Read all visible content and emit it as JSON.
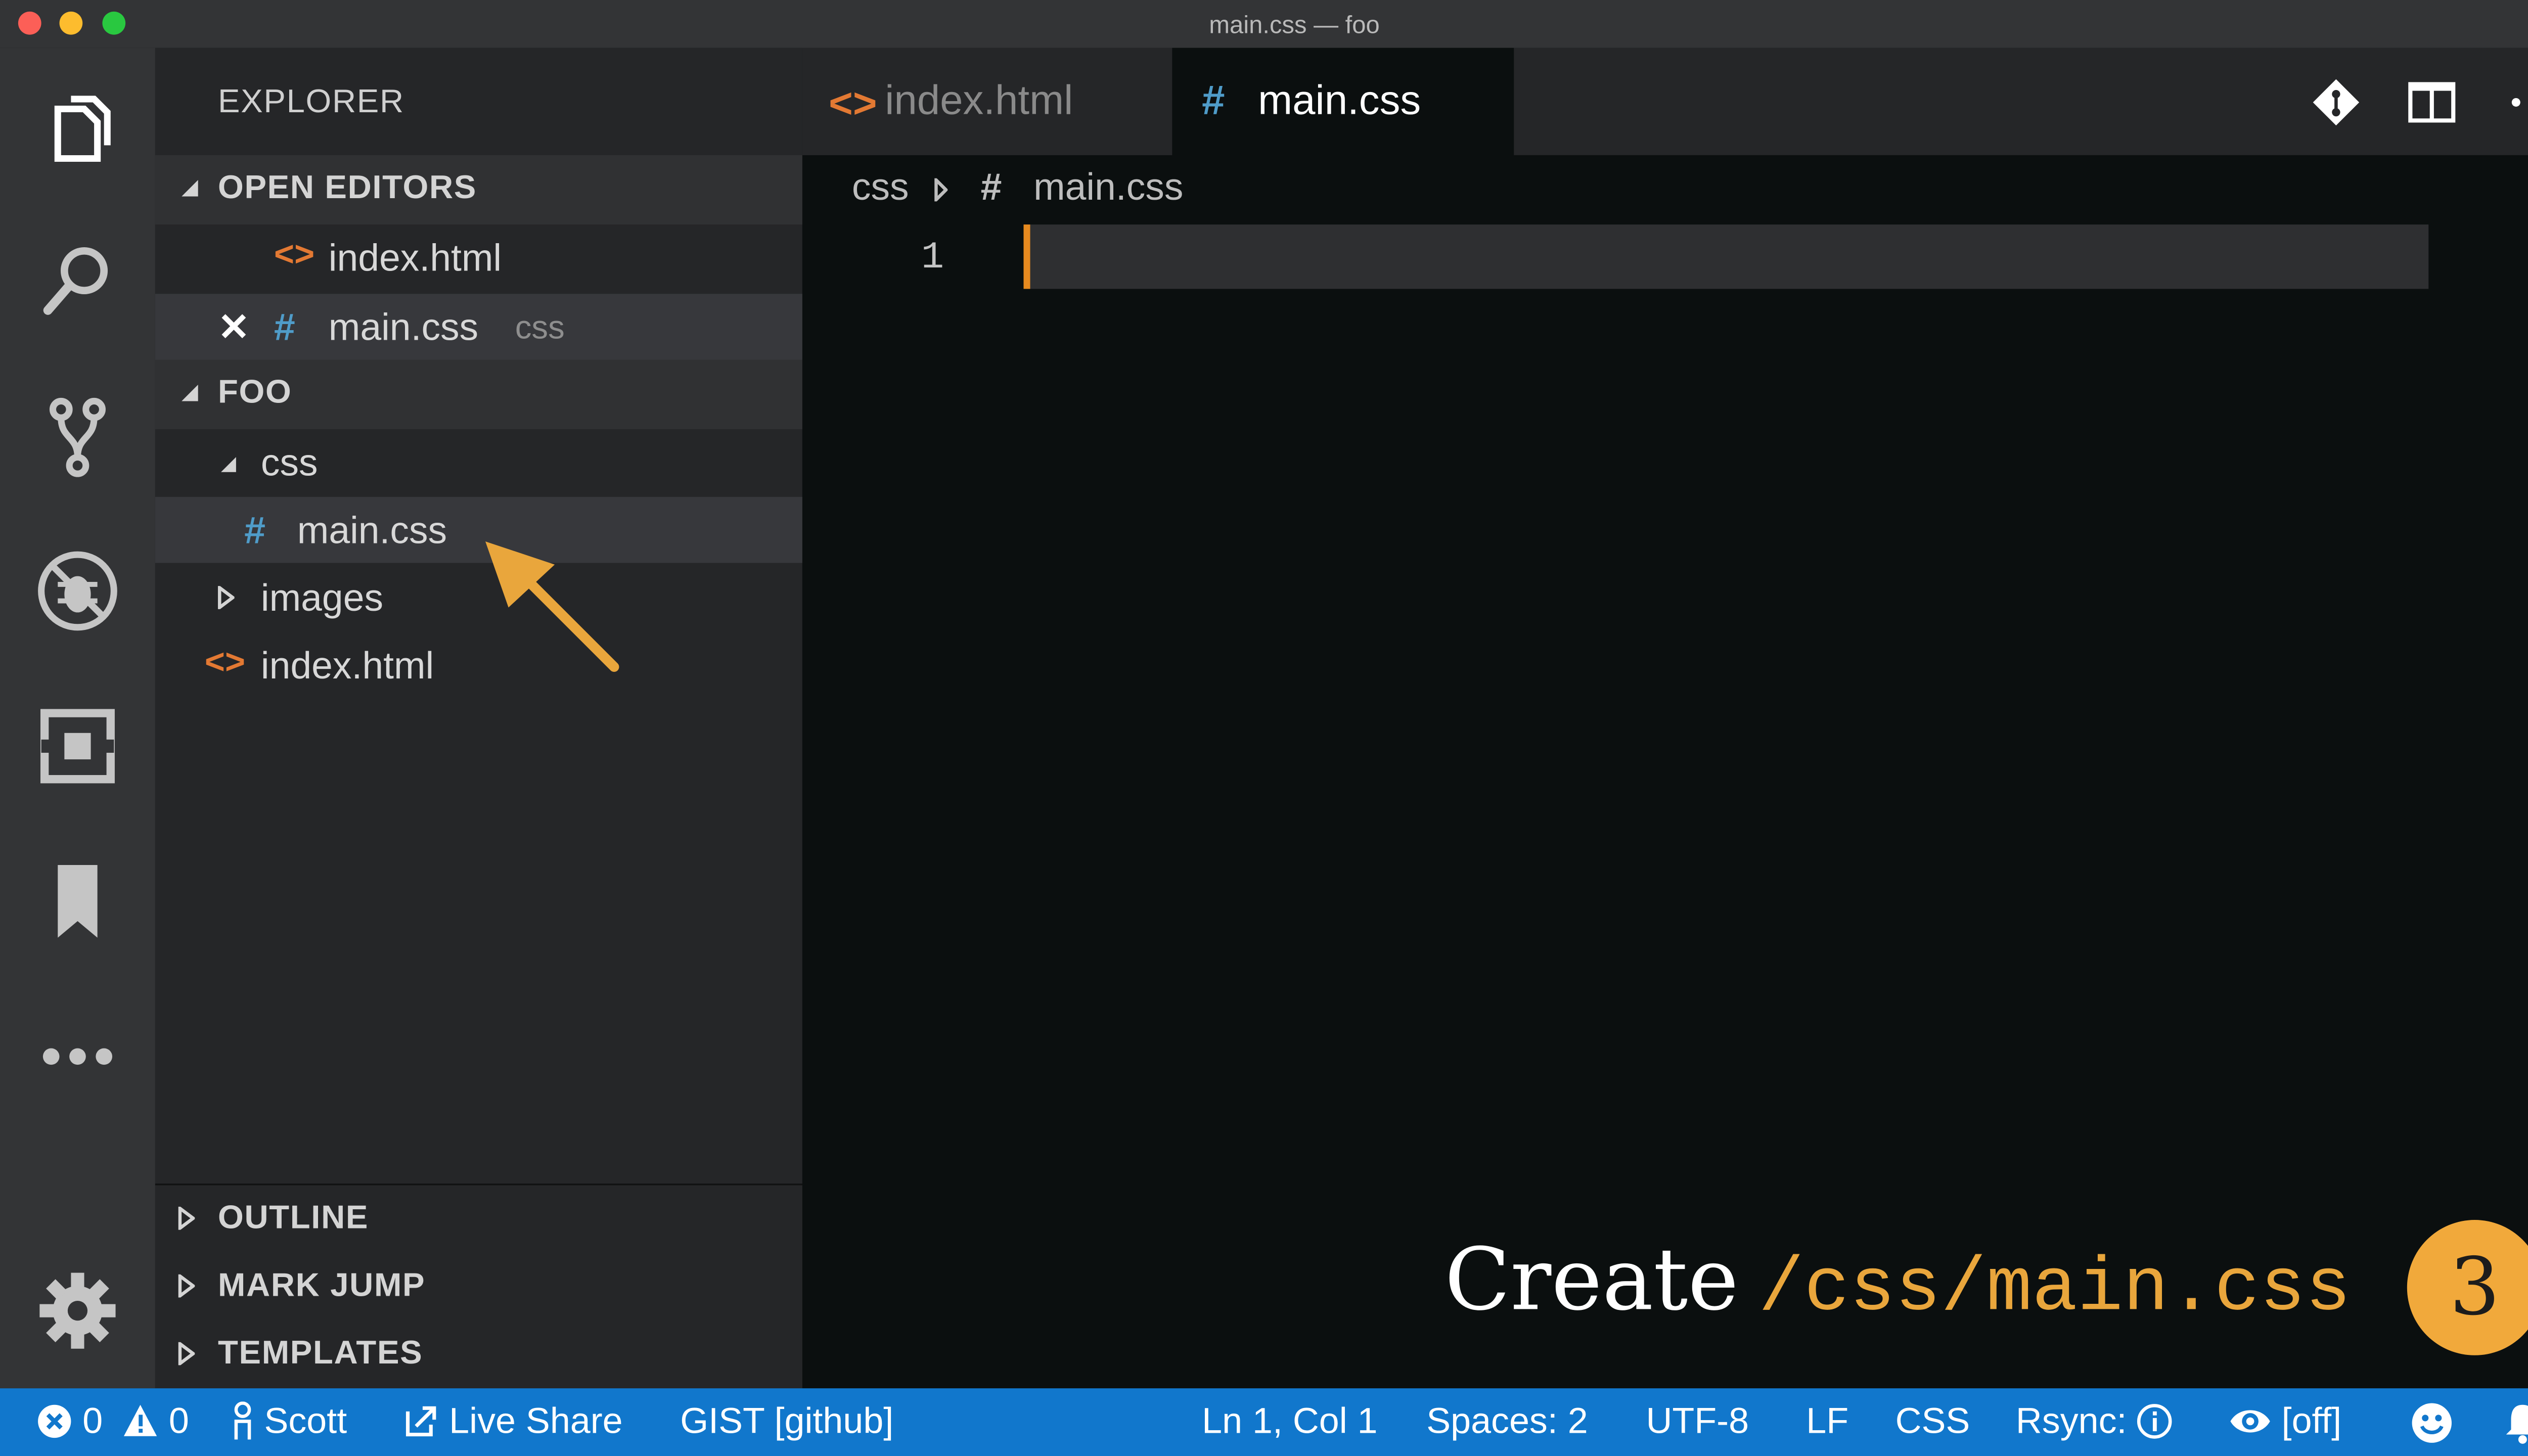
{
  "window": {
    "title": "main.css — foo"
  },
  "activity_bar": [
    "files-icon",
    "search-icon",
    "source-control-icon",
    "debug-icon",
    "extensions-icon",
    "bookmark-icon",
    "more-icon",
    "gear-icon"
  ],
  "sidebar": {
    "title": "EXPLORER",
    "open_editors": {
      "label": "OPEN EDITORS",
      "items": [
        {
          "icon": "<>",
          "name": "index.html"
        },
        {
          "icon": "#",
          "name": "main.css",
          "folder": "css",
          "close": "✕"
        }
      ]
    },
    "folder": {
      "label": "FOO",
      "tree": [
        {
          "name": "css",
          "expanded": true
        },
        {
          "name": "main.css",
          "icon": "#"
        },
        {
          "name": "images",
          "expanded": false
        },
        {
          "name": "index.html",
          "icon": "<>"
        }
      ]
    },
    "bottom_sections": [
      "OUTLINE",
      "MARK JUMP",
      "TEMPLATES"
    ]
  },
  "tabs": [
    {
      "icon": "<>",
      "label": "index.html",
      "active": false
    },
    {
      "icon": "#",
      "label": "main.css",
      "active": true
    }
  ],
  "editor": {
    "breadcrumb": {
      "folder": "css",
      "icon": "#",
      "file": "main.css"
    },
    "line_number": "1"
  },
  "caption": {
    "word": "Create",
    "path": "/css/main.css",
    "step": "3"
  },
  "statusbar": {
    "errors": "0",
    "warnings": "0",
    "user": "Scott",
    "live_share": "Live Share",
    "gist": "GIST [github]",
    "position": "Ln 1, Col 1",
    "spaces": "Spaces: 2",
    "encoding": "UTF-8",
    "eol": "LF",
    "language": "CSS",
    "rsync": "Rsync:",
    "eye_state": "[off]"
  },
  "colors": {
    "accent": "#1177cc",
    "css_icon": "#4f9cc9",
    "html_icon": "#e37933",
    "caption_path": "#e9a63c"
  }
}
